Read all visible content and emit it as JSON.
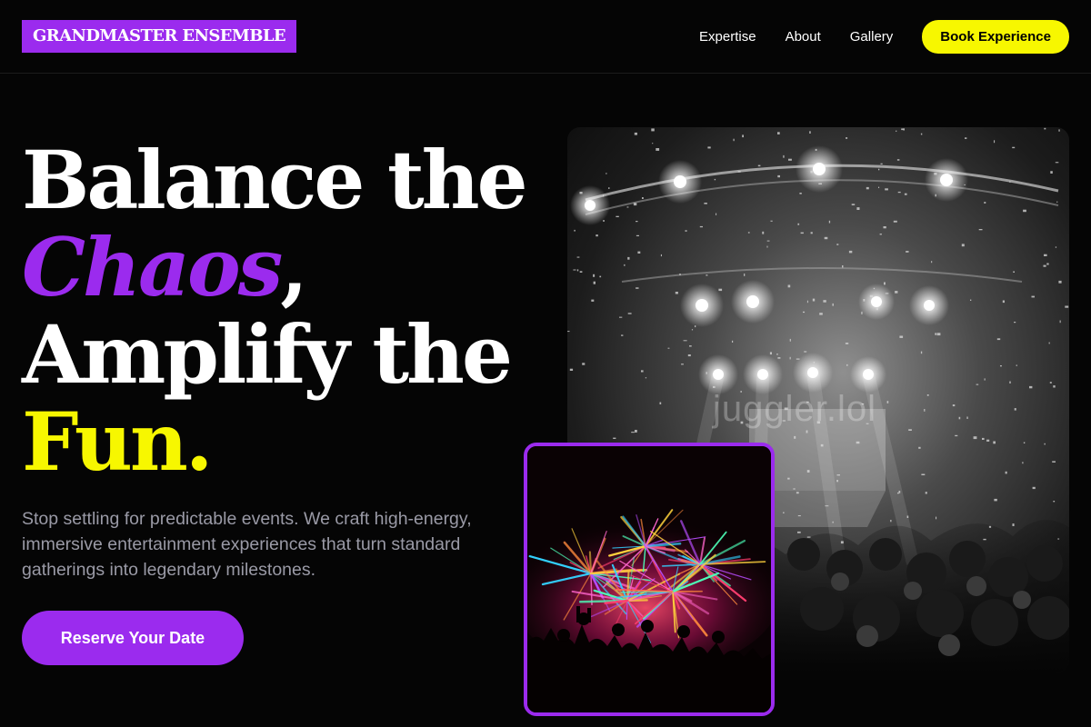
{
  "header": {
    "logo": "GRANDMASTER ENSEMBLE",
    "nav": [
      "Expertise",
      "About",
      "Gallery"
    ],
    "cta": "Book Experience"
  },
  "hero": {
    "line1": "Balance the",
    "chaos": "Chaos",
    "comma": ",",
    "line3": "Amplify the",
    "fun": "Fun",
    "period": ".",
    "subtext": "Stop settling for predictable events. We craft high-energy, immersive entertainment experiences that turn standard gatherings into legendary milestones.",
    "cta": "Reserve Your Date"
  },
  "images": {
    "concert_watermark": "juggler.lol"
  },
  "colors": {
    "accent_purple": "#9b2bee",
    "accent_yellow": "#f7f700",
    "background": "#050505"
  }
}
